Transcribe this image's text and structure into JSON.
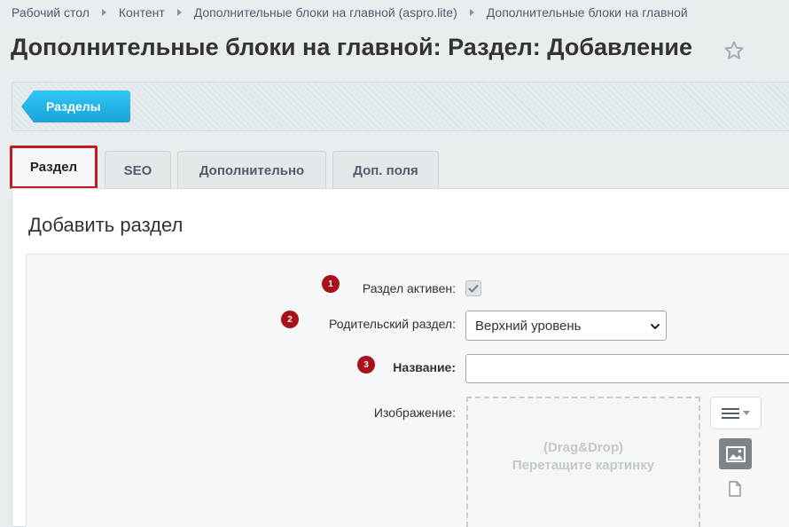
{
  "breadcrumbs": [
    "Рабочий стол",
    "Контент",
    "Дополнительные блоки на главной (aspro.lite)",
    "Дополнительные блоки на главной"
  ],
  "page_title": "Дополнительные блоки на главной: Раздел: Добавление",
  "toolbar": {
    "sections_button": "Разделы"
  },
  "tabs": [
    {
      "label": "Раздел",
      "active": true
    },
    {
      "label": "SEO",
      "active": false
    },
    {
      "label": "Дополнительно",
      "active": false
    },
    {
      "label": "Доп. поля",
      "active": false
    }
  ],
  "panel_title": "Добавить раздел",
  "form": {
    "active": {
      "badge": "1",
      "label": "Раздел активен:",
      "checked": true
    },
    "parent": {
      "badge": "2",
      "label": "Родительский раздел:",
      "value": "Верхний уровень"
    },
    "name": {
      "badge": "3",
      "label": "Название:",
      "value": ""
    },
    "image": {
      "label": "Изображение:",
      "drop_line1": "(Drag&Drop)",
      "drop_line2": "Перетащите картинку"
    }
  },
  "colors": {
    "accent_button": "#2fc6f6",
    "badge": "#a8111b",
    "active_tab_outline": "#c21a21"
  }
}
